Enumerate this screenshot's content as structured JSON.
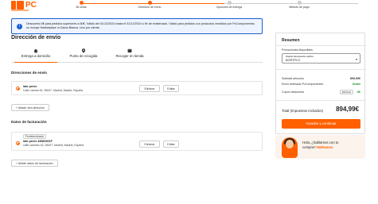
{
  "brand": {
    "logo_text": "PC",
    "accent": "#ff6000"
  },
  "steps": [
    {
      "label": "Mi cesta",
      "state": "done"
    },
    {
      "label": "Dirección de envío",
      "state": "current"
    },
    {
      "label": "Opciones de entrega",
      "state": "todo"
    },
    {
      "label": "Método de pago",
      "state": "todo"
    }
  ],
  "notice": {
    "icon": "info-icon",
    "text": "Descuento 5€ para pedidos superiores a 60€. Válido del 01/12/2024 hasta el 31/12/2024 o fin de existencias. Válido para pedidos con productos vendidos por PcComponentes; no incluye Marketplace ni Gama Blanca. Uno por cliente."
  },
  "page_title": "Dirección de envío",
  "tabs": [
    {
      "label": "Entrega a domicilio",
      "icon": "home-icon",
      "active": true
    },
    {
      "label": "Punto de recogida",
      "icon": "pin-icon",
      "active": false
    },
    {
      "label": "Recoger en tienda",
      "icon": "store-icon",
      "active": false
    }
  ],
  "shipping": {
    "heading": "Direcciones de envío",
    "address": {
      "name": "iato perez",
      "line": "Calle carmel 45, 28007, Madrid, Madrid, España"
    },
    "delete_label": "Eliminar",
    "edit_label": "Editar",
    "add_label": "+ Añadir otra dirección"
  },
  "billing": {
    "heading": "Datos de facturación",
    "badge": "Predeterminada",
    "address": {
      "name": "iato perez 43881661F",
      "line": "calle carmelo 43, 28007, Madrid, Madrid, España"
    },
    "delete_label": "Eliminar",
    "edit_label": "Editar",
    "add_label": "+ Añadir datos de facturación"
  },
  "summary": {
    "title": "Resumen",
    "promos_label": "Promociones disponibles",
    "coupon_field_label": "Cupón descuento activo",
    "coupon_value": "BORTPCC",
    "subtotal_label": "Subtotal artículos",
    "subtotal_value": "899,99€",
    "shipping_label": "Envío estimado PcComponentes",
    "shipping_value": "Gratis",
    "coupon_row_label": "Cupón descuento",
    "coupon_row_tag": "Eliminar",
    "coupon_row_value": "-5€",
    "total_label": "Total (Impuestos incluidos)",
    "total_value": "894,99€",
    "cta_label": "Guardar y continuar"
  },
  "chat": {
    "line1": "Hola, ¿hablamos con tu",
    "line2_prefix": "compra?",
    "line2_link": "Hablamos"
  }
}
